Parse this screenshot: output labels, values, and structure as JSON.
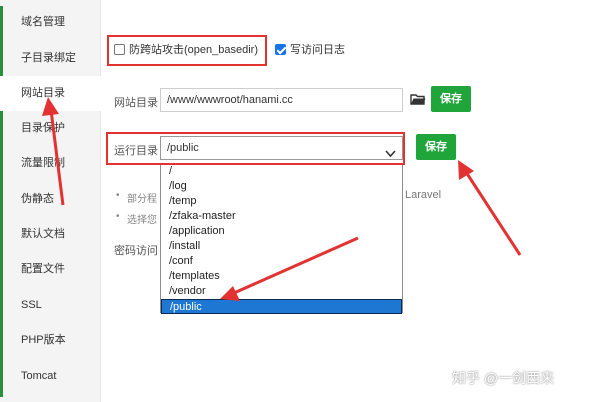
{
  "sidebar": {
    "items": [
      {
        "label": "域名管理"
      },
      {
        "label": "子目录绑定"
      },
      {
        "label": "网站目录"
      },
      {
        "label": "目录保护"
      },
      {
        "label": "流量限制"
      },
      {
        "label": "伪静态"
      },
      {
        "label": "默认文档"
      },
      {
        "label": "配置文件"
      },
      {
        "label": "SSL"
      },
      {
        "label": "PHP版本"
      },
      {
        "label": "Tomcat"
      }
    ],
    "active": "网站目录"
  },
  "options": {
    "anti_xss_label": "防跨站攻击(open_basedir)",
    "anti_xss_checked": false,
    "access_log_label": "写访问日志",
    "access_log_checked": true
  },
  "site_dir": {
    "label": "网站目录",
    "value": "/www/wwwroot/hanami.cc",
    "save_label": "保存"
  },
  "run_dir": {
    "label": "运行目录",
    "value": "/public",
    "save_label": "保存",
    "options": [
      "/",
      "/log",
      "/temp",
      "/zfaka-master",
      "/application",
      "/install",
      "/conf",
      "/templates",
      "/vendor",
      "/public"
    ],
    "selected": "/public"
  },
  "tips": {
    "tip1": "部分程",
    "tip1_suffix": "Laravel",
    "tip2": "选择您"
  },
  "password": {
    "label": "密码访问"
  },
  "watermark": "知乎 @一剑西来",
  "colors": {
    "save_green": "#20a53a",
    "annotation_red": "#e23232",
    "selection_blue": "#1e77d3"
  }
}
